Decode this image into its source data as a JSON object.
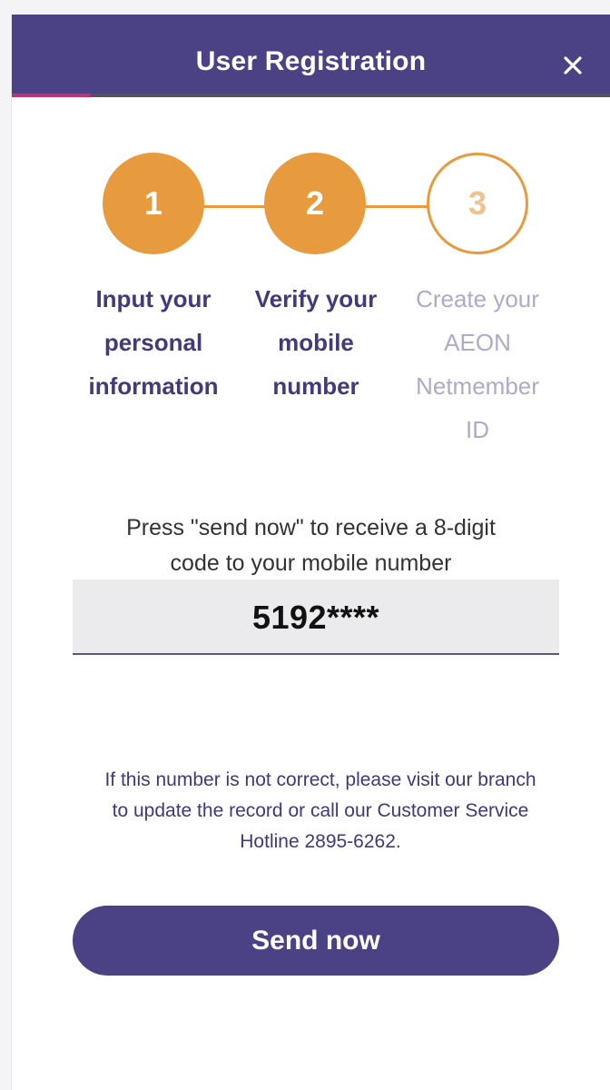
{
  "header": {
    "title": "User Registration",
    "close_icon": "close-icon",
    "progress_percent": 13
  },
  "stepper": {
    "steps": [
      {
        "number": "1",
        "label_lines": [
          "Input your",
          "personal",
          "information"
        ],
        "state": "completed"
      },
      {
        "number": "2",
        "label_lines": [
          "Verify your",
          "mobile",
          "number"
        ],
        "state": "current"
      },
      {
        "number": "3",
        "label_lines": [
          "Create your",
          "AEON",
          "Netmember",
          "ID"
        ],
        "state": "pending"
      }
    ]
  },
  "main": {
    "instruction_lines": [
      "Press \"send now\" to receive a 8-digit",
      "code to your mobile number"
    ],
    "phone_number": "5192****",
    "notice_lines": [
      "If this number is not correct, please visit our branch",
      "to update the record or call our Customer Service",
      "Hotline 2895-6262."
    ],
    "send_button_label": "Send now"
  },
  "colors": {
    "header_bg": "#4b4286",
    "accent_orange": "#e89a3f",
    "progress_fill": "#c0307f",
    "text_purple": "#433a7e",
    "text_inactive": "#aeaac8"
  }
}
